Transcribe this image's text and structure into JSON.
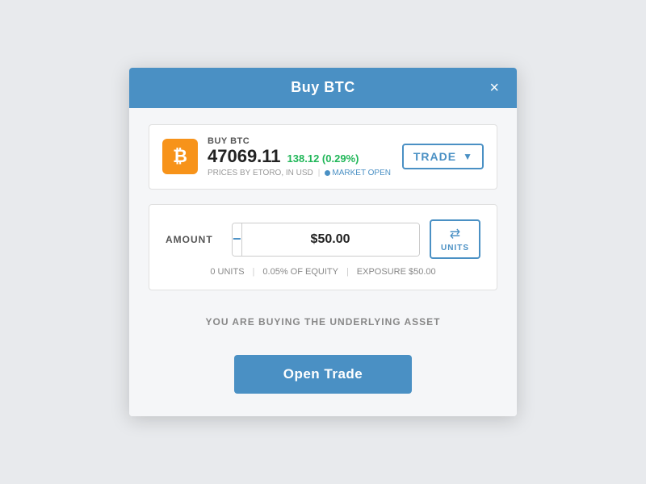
{
  "modal": {
    "title": "Buy BTC",
    "close_label": "×"
  },
  "asset": {
    "icon_symbol": "₿",
    "buy_label": "BUY BTC",
    "price": "47069.11",
    "change": "138.12 (0.29%)",
    "meta": "PRICES BY ETORO, IN USD",
    "market_status": "MARKET OPEN"
  },
  "trade_dropdown": {
    "label": "TRADE",
    "arrow": "▼"
  },
  "amount": {
    "label": "AMOUNT",
    "value": "$50.00",
    "minus": "−",
    "plus": "+"
  },
  "units_toggle": {
    "icon": "⇄",
    "label": "UNITS"
  },
  "amount_meta": {
    "units": "0 UNITS",
    "equity": "0.05% OF EQUITY",
    "exposure": "EXPOSURE $50.00"
  },
  "underlying_msg": "YOU ARE BUYING THE UNDERLYING ASSET",
  "open_trade_btn": "Open Trade"
}
